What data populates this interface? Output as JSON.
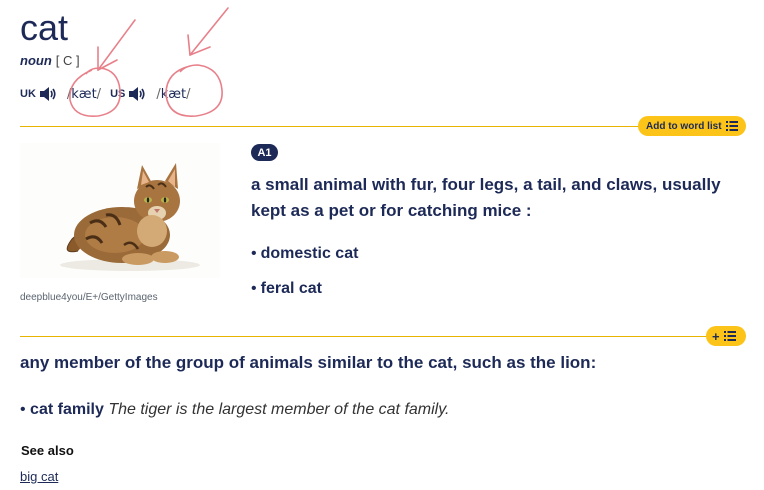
{
  "headword": "cat",
  "part_of_speech": "noun",
  "grammar": "[ C ]",
  "pronunciations": [
    {
      "region": "UK",
      "ipa": "kæt"
    },
    {
      "region": "US",
      "ipa": "kæt"
    }
  ],
  "add_to_word_list": "Add to word list",
  "add_short": "+",
  "image_credit": "deepblue4you/E+/GettyImages",
  "sense1": {
    "level": "A1",
    "definition": "a small animal with fur, four legs, a tail, and claws, usually kept as a pet or for catching mice :",
    "examples": [
      "domestic cat",
      "feral cat"
    ]
  },
  "sense2": {
    "definition": "any member of the group of animals similar to the cat, such as the lion:",
    "example_phrase": "cat family",
    "example_sentence": "The tiger is the largest member of the cat family."
  },
  "see_also": {
    "heading": "See also",
    "link": "big cat"
  },
  "colors": {
    "accent": "#fcc419",
    "text": "#1d2a57",
    "annotation": "#e8808a"
  },
  "icons": [
    "speaker-icon",
    "list-icon",
    "plus-icon",
    "arrow-annotation",
    "circle-annotation"
  ]
}
